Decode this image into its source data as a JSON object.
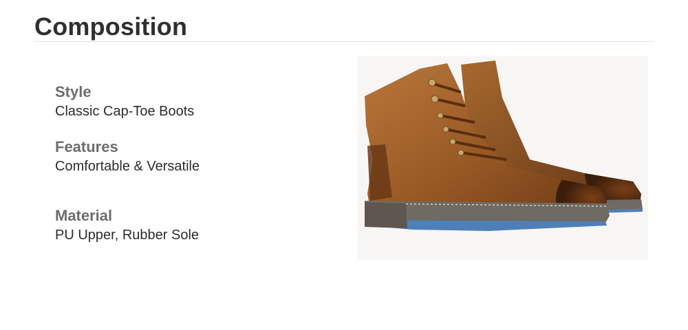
{
  "section": {
    "title": "Composition"
  },
  "specs": [
    {
      "label": "Style",
      "value": "Classic Cap-Toe Boots"
    },
    {
      "label": "Features",
      "value": "Comfortable & Versatile"
    },
    {
      "label": "Material",
      "value": "PU Upper, Rubber Sole"
    }
  ],
  "product_image": {
    "subject": "brown-leather-lace-up-boots"
  },
  "colors": {
    "leather": "#9a5a25",
    "leather_dark": "#5e3314",
    "sole": "#6f6a62",
    "sole_edge": "#4f7fb8"
  }
}
